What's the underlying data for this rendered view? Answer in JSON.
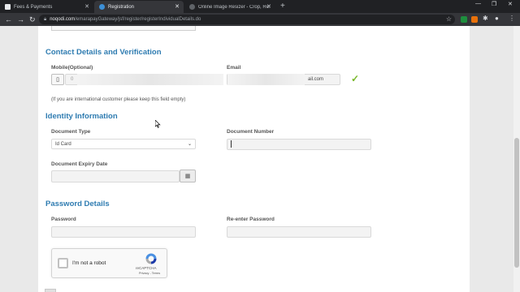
{
  "browser": {
    "tabs": [
      {
        "title": "Fees & Payments",
        "active": false,
        "favicon_color": "#e8eaed"
      },
      {
        "title": "Registration",
        "active": true,
        "favicon_color": "#3c8fd6"
      },
      {
        "title": "Online Image Resizer - Crop, Re...",
        "active": false,
        "favicon_color": "#5f6368"
      }
    ],
    "new_tab_icon": "plus-icon",
    "url_host": "noqodi.com",
    "url_path": "/emarapayGateway/jsf/register/registerIndividualDetails.do"
  },
  "contact": {
    "title": "Contact Details and Verification",
    "mobile_label": "Mobile(Optional)",
    "mobile_value": "0",
    "email_label": "Email",
    "email_value": "ail.com",
    "note": "(If you are international customer please keep this field empty)"
  },
  "identity": {
    "title": "Identity Information",
    "doc_type_label": "Document Type",
    "doc_type_value": "Id Card",
    "doc_number_label": "Document Number",
    "doc_number_value": "",
    "expiry_label": "Document Expiry Date",
    "expiry_value": ""
  },
  "password": {
    "title": "Password Details",
    "password_label": "Password",
    "reenter_label": "Re-enter Password"
  },
  "recaptcha": {
    "label": "I'm not a robot",
    "brand": "reCAPTCHA",
    "links": "Privacy - Terms"
  },
  "colors": {
    "section_title": "#2f7cb1",
    "check": "#78b829"
  }
}
